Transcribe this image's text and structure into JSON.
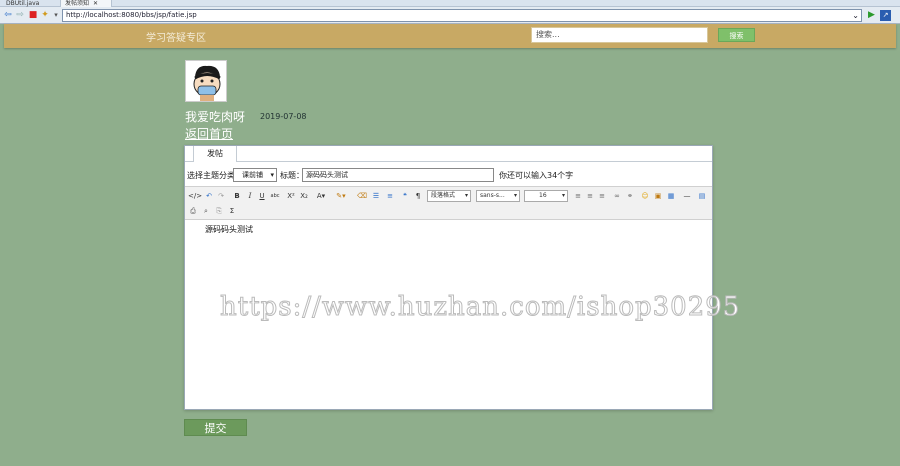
{
  "browser": {
    "tabs": [
      {
        "label": "DBUtil.java"
      },
      {
        "label": "发帖须知",
        "close": "✕"
      }
    ],
    "url": "http://localhost:8080/bbs/jsp/fatie.jsp",
    "icons": [
      "back-icon",
      "forward-icon",
      "stop-icon",
      "refresh-icon",
      "home-icon",
      "dropdown-icon",
      "go-icon",
      "external-icon"
    ]
  },
  "header": {
    "brand": "学习答疑专区",
    "search_placeholder": "搜索...",
    "search_button": "搜索"
  },
  "user": {
    "name": "我爱吃肉呀",
    "date": "2019-07-08",
    "back_link": "返回首页"
  },
  "panel": {
    "tab": "发帖",
    "form": {
      "category_label": "选择主题分类",
      "category_value": "课前铺",
      "title_label": "标题：",
      "title_value": "源码码头测试",
      "hint": "你还可以输入34个字"
    },
    "toolbar": {
      "font_format": "段落格式",
      "font_family": "sans-s...",
      "font_size": "16"
    },
    "editor_content": "源码码头测试"
  },
  "watermark": "https://www.huzhan.com/ishop30295",
  "submit_label": "提交",
  "colors": {
    "page_bg": "#8fae8c",
    "header_bg": "#c8a964",
    "search_btn": "#7fc06a",
    "submit_btn": "#6c9a5c"
  }
}
